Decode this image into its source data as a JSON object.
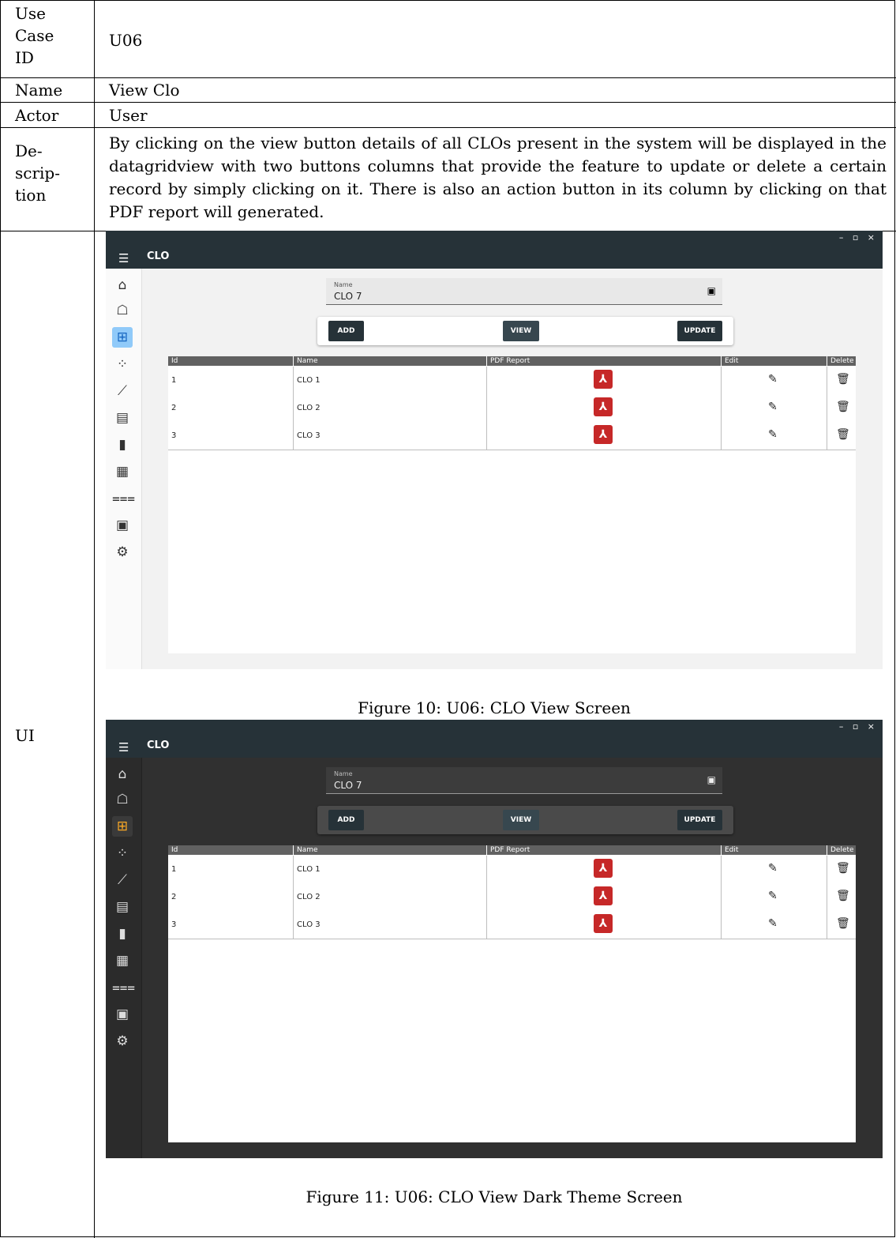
{
  "table": {
    "use_case_id_label": "Use Case ID",
    "use_case_id_lines": [
      "Use",
      "Case",
      "ID"
    ],
    "use_case_id": "U06",
    "name_label": "Name",
    "name": "View Clo",
    "actor_label": "Actor",
    "actor": "User",
    "description_label_lines": [
      "De-",
      "scrip-",
      "tion"
    ],
    "description": "By clicking on the view button details of all CLOs present in the system will be displayed in the datagridview with two buttons columns that provide the feature to update or delete a certain record by simply clicking on it. There is also an action button in its column by clicking on that PDF report will generated.",
    "ui_label": "UI"
  },
  "figures": [
    {
      "caption": "Figure 10: U06: CLO View Screen",
      "theme": "light",
      "app": {
        "title": "CLO",
        "window_controls": "– ▫ ×",
        "menu_icon": "hamburger-menu-icon",
        "sidebar_icons": [
          "home-icon",
          "graduation-cap-icon",
          "tree-structure-icon",
          "scatter-icon",
          "ruler-icon",
          "calendar-icon",
          "cards-icon",
          "calculator-icon",
          "checklist-icon",
          "pdf-file-icon",
          "gear-icon"
        ],
        "selected_sidebar_index": 2,
        "name_field": {
          "label": "Name",
          "value": "CLO 7",
          "icon": "contact-card-icon"
        },
        "buttons": {
          "add": "ADD",
          "view": "VIEW",
          "update": "UPDATE"
        },
        "grid": {
          "columns": [
            "Id",
            "Name",
            "PDF Report",
            "Edit",
            "Delete"
          ],
          "rows": [
            {
              "id": "1",
              "name": "CLO 1"
            },
            {
              "id": "2",
              "name": "CLO 2"
            },
            {
              "id": "3",
              "name": "CLO 3"
            }
          ],
          "pdf_icon": "adobe-pdf-icon",
          "edit_icon": "pencil-icon",
          "delete_icon": "trash-icon"
        }
      }
    },
    {
      "caption": "Figure 11: U06: CLO View Dark Theme Screen",
      "theme": "dark",
      "app": {
        "title": "CLO",
        "window_controls": "– ▫ ×",
        "menu_icon": "hamburger-menu-icon",
        "sidebar_icons": [
          "home-icon",
          "graduation-cap-icon",
          "tree-structure-icon",
          "scatter-icon",
          "ruler-icon",
          "calendar-icon",
          "cards-icon",
          "calculator-icon",
          "checklist-icon",
          "pdf-file-icon",
          "gear-icon"
        ],
        "selected_sidebar_index": 2,
        "name_field": {
          "label": "Name",
          "value": "CLO 7",
          "icon": "contact-card-icon"
        },
        "buttons": {
          "add": "ADD",
          "view": "VIEW",
          "update": "UPDATE"
        },
        "grid": {
          "columns": [
            "Id",
            "Name",
            "PDF Report",
            "Edit",
            "Delete"
          ],
          "rows": [
            {
              "id": "1",
              "name": "CLO 1"
            },
            {
              "id": "2",
              "name": "CLO 2"
            },
            {
              "id": "3",
              "name": "CLO 3"
            }
          ],
          "pdf_icon": "adobe-pdf-icon",
          "edit_icon": "pencil-icon",
          "delete_icon": "trash-icon"
        }
      }
    }
  ]
}
